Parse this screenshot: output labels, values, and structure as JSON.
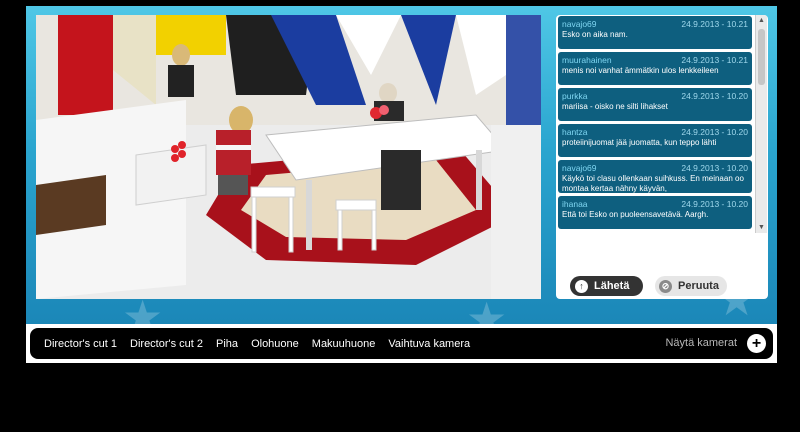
{
  "chat": {
    "messages": [
      {
        "user": "navajo69",
        "time": "24.9.2013 - 10.21",
        "text": "Esko on aika nam."
      },
      {
        "user": "muurahainen",
        "time": "24.9.2013 - 10.21",
        "text": "menis noi vanhat ämmätkin ulos lenkkeileen"
      },
      {
        "user": "purkka",
        "time": "24.9.2013 - 10.20",
        "text": "mariisa - oisko ne silti lihakset"
      },
      {
        "user": "hantza",
        "time": "24.9.2013 - 10.20",
        "text": "proteiinijuomat jää juomatta, kun teppo lähti"
      },
      {
        "user": "navajo69",
        "time": "24.9.2013 - 10.20",
        "text": "Käykö toi clasu ollenkaan suihkuss. En meinaan oo montaa kertaa nähny käyvän,"
      },
      {
        "user": "ihanaa",
        "time": "24.9.2013 - 10.20",
        "text": "Että toi Esko on puoleensavetävä. Aargh."
      }
    ],
    "input_value": "",
    "send_label": "Lähetä",
    "cancel_label": "Peruuta"
  },
  "cameras": {
    "tabs": [
      "Director's cut 1",
      "Director's cut 2",
      "Piha",
      "Olohuone",
      "Makuuhuone",
      "Vaihtuva kamera"
    ],
    "show_label": "Näytä kamerat"
  },
  "colors": {
    "background": "#000000",
    "stage_blue": "#2aa5cf",
    "message_bg": "#0e5f7f",
    "message_user": "#7fd6f2"
  },
  "icons": {
    "send": "arrow-up-icon",
    "cancel": "cancel-circle-icon",
    "show_cameras": "plus-icon"
  }
}
